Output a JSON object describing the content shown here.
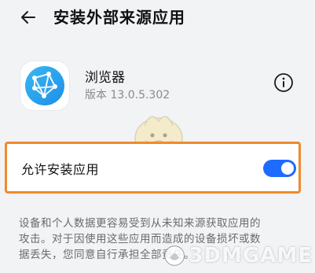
{
  "header": {
    "title": "安装外部来源应用",
    "back_icon": "back-arrow-icon"
  },
  "app": {
    "name": "浏览器",
    "version": "版本 13.0.5.302",
    "icon": "browser-globe-icon",
    "info_icon": "info-icon"
  },
  "setting": {
    "label": "允许安装应用",
    "toggle_on": true,
    "toggle_color": "#1e6bff",
    "highlight_color": "#f08a2c"
  },
  "warning": {
    "lines": [
      "设备和个人数据更容易受到从未知来源获取应用的",
      "攻击。对于因使用这些应用而造成的设备损坏或数",
      "据丢失，您同意自行承担全部责任。"
    ]
  },
  "watermark": {
    "text": "3DMGAME"
  }
}
